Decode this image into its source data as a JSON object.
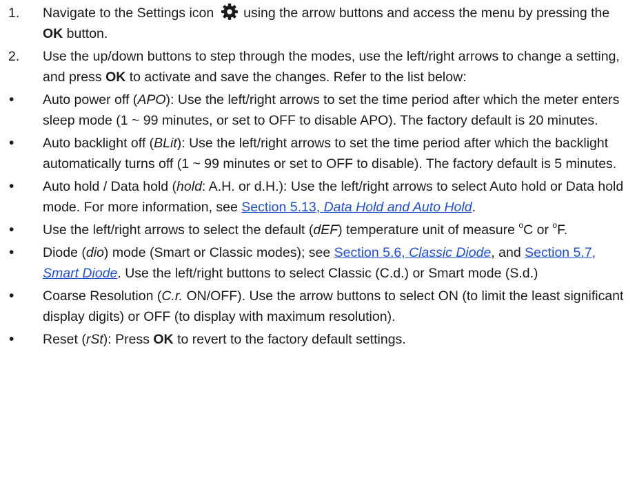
{
  "steps": [
    {
      "num": "1.",
      "a": "Navigate to the Settings icon",
      "b": "using the arrow buttons and access the menu by pressing the",
      "c": "OK",
      "d": "button."
    },
    {
      "num": "2.",
      "a": "Use the up/down buttons to step through the modes, use the left/right arrows to change a setting, and press",
      "b": "OK",
      "c": "to activate and save the changes. Refer to the list below:"
    }
  ],
  "bullet_char": "•",
  "settings_icon": "gear-icon",
  "link_color": "#1f4ed8",
  "bullets": {
    "apo": {
      "a": "Auto power off (",
      "code": "APO",
      "b": "): Use the left/right arrows to set the time period after which the meter enters sleep mode (1 ~ 99 minutes, or set to OFF to disable APO). The factory default is 20 minutes."
    },
    "blit": {
      "a": "Auto backlight off (",
      "code": "BLit",
      "b": "): Use the left/right arrows to set the time period after which the backlight automatically turns off (1 ~ 99 minutes or set to OFF to disable). The factory default is 5 minutes."
    },
    "hold": {
      "a": "Auto hold / Data hold (",
      "code": "hold",
      "b": ": A.H. or d.H.): Use the left/right arrows to select Auto hold or Data hold mode. For more information, see",
      "link_plain": "Section 5.13,",
      "link_italic": "Data Hold and Auto Hold",
      "end": "."
    },
    "def": {
      "a": "Use the left/right arrows to select the default (",
      "code": "dEF",
      "b": ") temperature unit of measure",
      "deg1": "o",
      "unit1": "C or",
      "deg2": "o",
      "unit2": "F."
    },
    "dio": {
      "a": "Diode (",
      "code": "dio",
      "b": ") mode (Smart or Classic modes); see",
      "link1_plain": "Section 5.6,",
      "link1_italic": "Classic Diode",
      "c": ", and",
      "link2_plain": "Section 5.7,",
      "link2_italic": "Smart Diode",
      "d": ". Use the left/right buttons to select Classic (C.d.) or Smart mode (S.d.)"
    },
    "cr": {
      "a": "Coarse Resolution (",
      "code": "C.r.",
      "b": "ON/OFF). Use the arrow buttons to select ON (to limit the least significant display digits) or OFF (to display with maximum resolution)."
    },
    "rst": {
      "a": "Reset (",
      "code": "rSt",
      "b": "): Press",
      "ok": "OK",
      "c": "to revert to the factory default settings."
    }
  }
}
